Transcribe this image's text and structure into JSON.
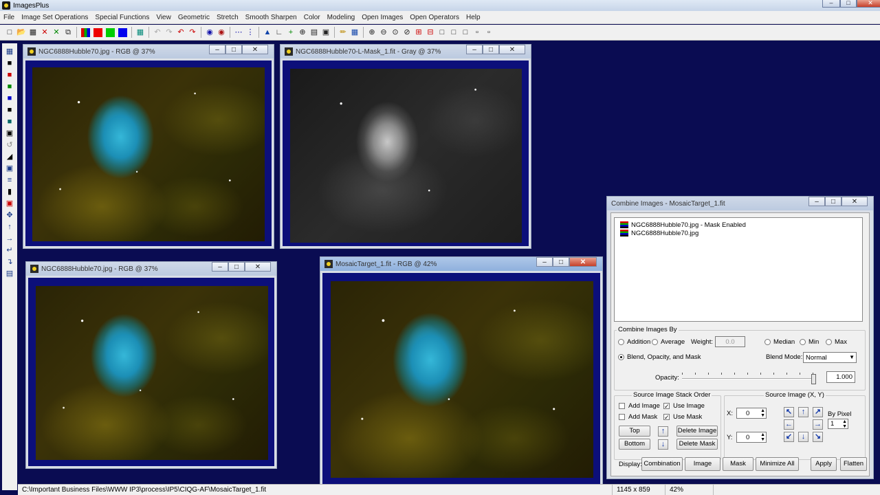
{
  "app": {
    "title": "ImagesPlus"
  },
  "menu": [
    "File",
    "Image Set Operations",
    "Special Functions",
    "View",
    "Geometric",
    "Stretch",
    "Smooth Sharpen",
    "Color",
    "Modeling",
    "Open Images",
    "Open Operators",
    "Help"
  ],
  "windows": {
    "win1": {
      "title": "NGC6888Hubble70.jpg - RGB @ 37%"
    },
    "win2": {
      "title": "NGC6888Hubble70-L-Mask_1.fit - Gray @ 37%"
    },
    "win3": {
      "title": "NGC6888Hubble70.jpg - RGB @ 37%"
    },
    "win4": {
      "title": "MosaicTarget_1.fit - RGB @ 42%"
    }
  },
  "combine": {
    "title": "Combine Images - MosaicTarget_1.fit",
    "list": [
      "NGC6888Hubble70.jpg - Mask Enabled",
      "NGC6888Hubble70.jpg"
    ],
    "by_label": "Combine Images By",
    "addition": "Addition",
    "average": "Average",
    "weight_label": "Weight:",
    "weight_value": "0.0",
    "median": "Median",
    "min": "Min",
    "max": "Max",
    "blend_option": "Blend, Opacity, and Mask",
    "blend_mode_label": "Blend Mode:",
    "blend_mode_value": "Normal",
    "opacity_label": "Opacity:",
    "opacity_value": "1.000",
    "opacity_fraction": 1.0,
    "stack_label": "Source Image Stack Order",
    "add_image": "Add Image",
    "use_image": "Use Image",
    "add_mask": "Add Mask",
    "use_mask": "Use Mask",
    "top": "Top",
    "bottom": "Bottom",
    "delete_image": "Delete Image",
    "delete_mask": "Delete Mask",
    "xy_label": "Source Image (X, Y)",
    "x_label": "X:",
    "x_value": "0",
    "y_label": "Y:",
    "y_value": "0",
    "by_pixel_label": "By Pixel",
    "by_pixel_value": "1",
    "display_label": "Display:",
    "combination": "Combination",
    "image": "Image",
    "mask": "Mask",
    "minimize_all": "Minimize All",
    "apply": "Apply",
    "flatten": "Flatten"
  },
  "status": {
    "path": "C:\\Important Business Files\\WWW IP3\\process\\IP5\\CIQG-AF\\MosaicTarget_1.fit",
    "dims": "1145 x 859",
    "zoom": "42%"
  }
}
